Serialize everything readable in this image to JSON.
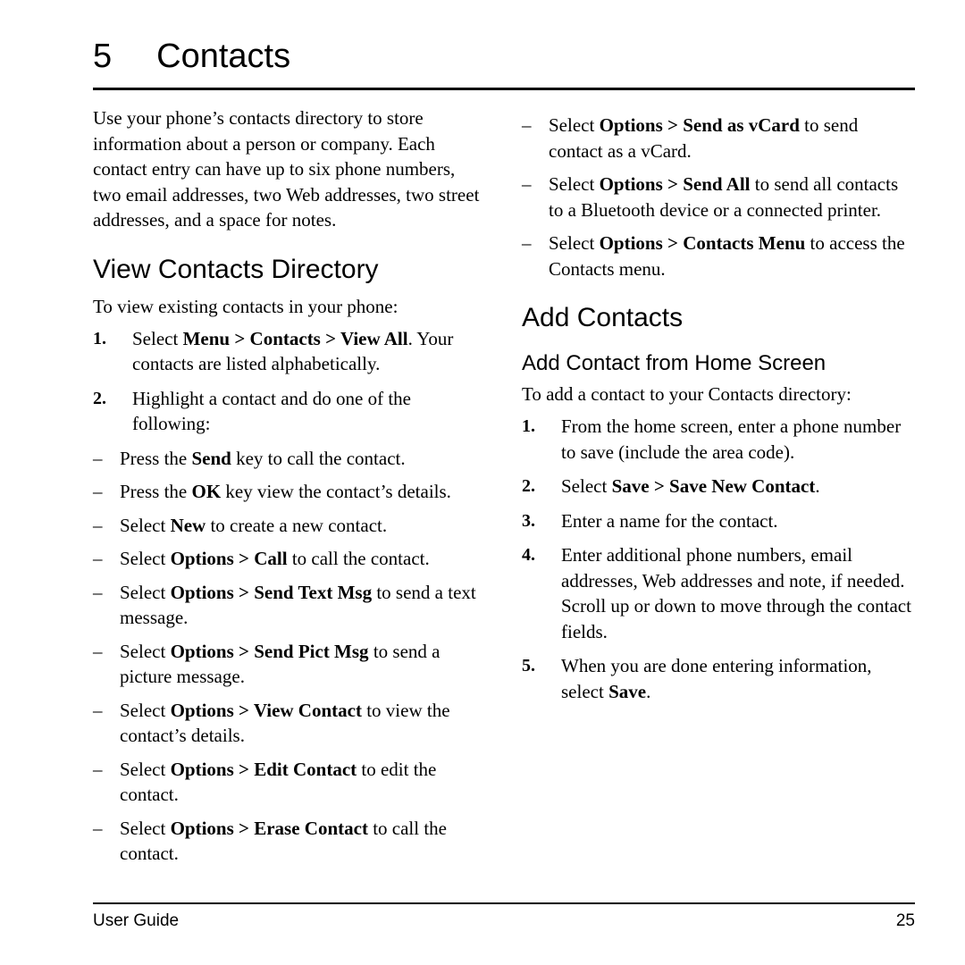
{
  "header": {
    "chapter_number": "5",
    "chapter_title": "Contacts"
  },
  "left_column": {
    "intro": "Use your phone’s contacts directory to store information about a person or company. Each contact entry can have up to six phone numbers, two email addresses, two Web addresses, two street addresses, and a space for notes.",
    "section_title": "View Contacts Directory",
    "lead": "To view existing contacts in your phone:",
    "steps": [
      {
        "num": "1.",
        "html": "Select <b>Menu &gt; Contacts &gt; View All</b>. Your contacts are listed alphabetically."
      },
      {
        "num": "2.",
        "html": "Highlight a contact and do one of the following:"
      }
    ],
    "dashes": [
      "Press the <b>Send</b> key to call the contact.",
      "Press the <b>OK</b> key view the contact’s details.",
      "Select <b>New</b> to create a new contact.",
      "Select <b>Options &gt; Call</b> to call the contact.",
      "Select <b>Options &gt; Send Text Msg</b> to send a text message.",
      "Select <b>Options &gt; Send Pict Msg</b> to send a picture message.",
      "Select <b>Options &gt; View Contact</b> to view the contact’s details.",
      "Select <b>Options &gt; Edit Contact</b> to edit the contact.",
      "Select <b>Options &gt; Erase Contact</b> to call the contact."
    ]
  },
  "right_column": {
    "dashes_continued": [
      "Select <b>Options &gt; Send as vCard</b> to send contact as a vCard.",
      "Select <b>Options &gt; Send All</b> to send all contacts to a Bluetooth device or a connected printer.",
      "Select <b>Options &gt; Contacts Menu</b> to access the Contacts menu."
    ],
    "section_title": "Add Contacts",
    "subsection_title": "Add Contact from Home Screen",
    "lead": "To add a contact to your Contacts directory:",
    "steps": [
      {
        "num": "1.",
        "html": "From the home screen, enter a phone number to save (include the area code)."
      },
      {
        "num": "2.",
        "html": "Select <b>Save &gt; Save New Contact</b>."
      },
      {
        "num": "3.",
        "html": "Enter a name for the contact."
      },
      {
        "num": "4.",
        "html": "Enter additional phone numbers, email addresses, Web addresses and note, if needed. Scroll up or down to move through the contact fields."
      },
      {
        "num": "5.",
        "html": "When you are done entering information, select <b>Save</b>."
      }
    ]
  },
  "footer": {
    "left": "User Guide",
    "page_number": "25"
  }
}
